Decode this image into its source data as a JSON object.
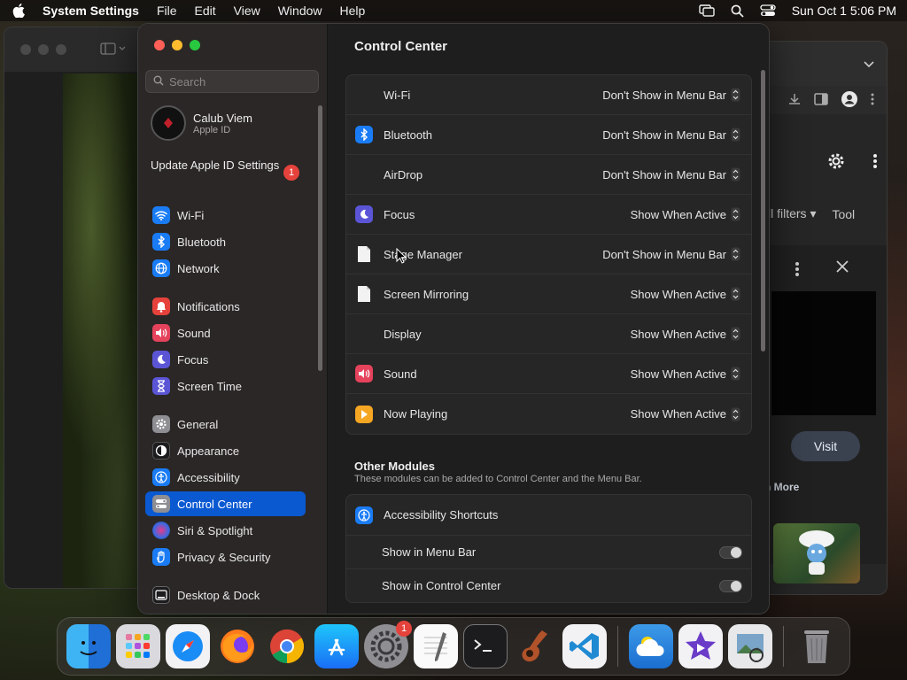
{
  "menubar": {
    "app_name": "System Settings",
    "menus": [
      "File",
      "Edit",
      "View",
      "Window",
      "Help"
    ],
    "clock": "Sun Oct 1  5:06 PM"
  },
  "background_browser": {
    "filters_label": "ll filters",
    "tools_label": "Tool",
    "visit_label": "Visit",
    "more_label": "n More"
  },
  "sidebar": {
    "search_placeholder": "Search",
    "account": {
      "name": "Calub Viem",
      "subtitle": "Apple ID"
    },
    "update": {
      "label": "Update Apple ID Settings",
      "badge": "1"
    },
    "items": [
      {
        "label": "Wi-Fi",
        "icon": "wifi-icon",
        "color": "#1a7cf5"
      },
      {
        "label": "Bluetooth",
        "icon": "bluetooth-icon",
        "color": "#1a7cf5"
      },
      {
        "label": "Network",
        "icon": "globe-icon",
        "color": "#1a7cf5"
      },
      {
        "label": "Notifications",
        "icon": "bell-icon",
        "color": "#e5423c"
      },
      {
        "label": "Sound",
        "icon": "speaker-icon",
        "color": "#e5425c"
      },
      {
        "label": "Focus",
        "icon": "moon-icon",
        "color": "#5b55d6"
      },
      {
        "label": "Screen Time",
        "icon": "hourglass-icon",
        "color": "#5b55d6"
      },
      {
        "label": "General",
        "icon": "gear-icon",
        "color": "#8e8e93"
      },
      {
        "label": "Appearance",
        "icon": "appearance-icon",
        "color": "#1c1c1e"
      },
      {
        "label": "Accessibility",
        "icon": "accessibility-icon",
        "color": "#1a7cf5"
      },
      {
        "label": "Control Center",
        "icon": "control-center-icon",
        "color": "#8e8e93"
      },
      {
        "label": "Siri & Spotlight",
        "icon": "siri-icon",
        "color": "#9b4fd1"
      },
      {
        "label": "Privacy & Security",
        "icon": "hand-icon",
        "color": "#1a7cf5"
      },
      {
        "label": "Desktop & Dock",
        "icon": "dock-icon",
        "color": "#1c1c1e"
      }
    ],
    "active_item": "Control Center"
  },
  "main": {
    "title": "Control Center",
    "modules": [
      {
        "label": "Wi-Fi",
        "value": "Don't Show in Menu Bar",
        "icon": "none"
      },
      {
        "label": "Bluetooth",
        "value": "Don't Show in Menu Bar",
        "icon": "bluetooth-icon"
      },
      {
        "label": "AirDrop",
        "value": "Don't Show in Menu Bar",
        "icon": "none"
      },
      {
        "label": "Focus",
        "value": "Show When Active",
        "icon": "moon-icon"
      },
      {
        "label": "Stage Manager",
        "value": "Don't Show in Menu Bar",
        "icon": "document-icon"
      },
      {
        "label": "Screen Mirroring",
        "value": "Show When Active",
        "icon": "document-icon"
      },
      {
        "label": "Display",
        "value": "Show When Active",
        "icon": "none"
      },
      {
        "label": "Sound",
        "value": "Show When Active",
        "icon": "speaker-icon"
      },
      {
        "label": "Now Playing",
        "value": "Show When Active",
        "icon": "play-icon"
      }
    ],
    "other_modules": {
      "title": "Other Modules",
      "subtitle": "These modules can be added to Control Center and the Menu Bar.",
      "accessibility_shortcuts": {
        "label": "Accessibility Shortcuts",
        "show_in_menu_bar": {
          "label": "Show in Menu Bar",
          "on": false
        },
        "show_in_control_center": {
          "label": "Show in Control Center",
          "on": false
        }
      }
    }
  },
  "dock": {
    "apps": [
      "Finder",
      "Launchpad",
      "Safari",
      "Firefox",
      "Chrome",
      "App Store",
      "System Settings",
      "TextEdit",
      "Terminal",
      "GarageBand",
      "VS Code",
      "Weather",
      "iMovie",
      "Preview",
      "Trash"
    ],
    "settings_badge": "1"
  }
}
